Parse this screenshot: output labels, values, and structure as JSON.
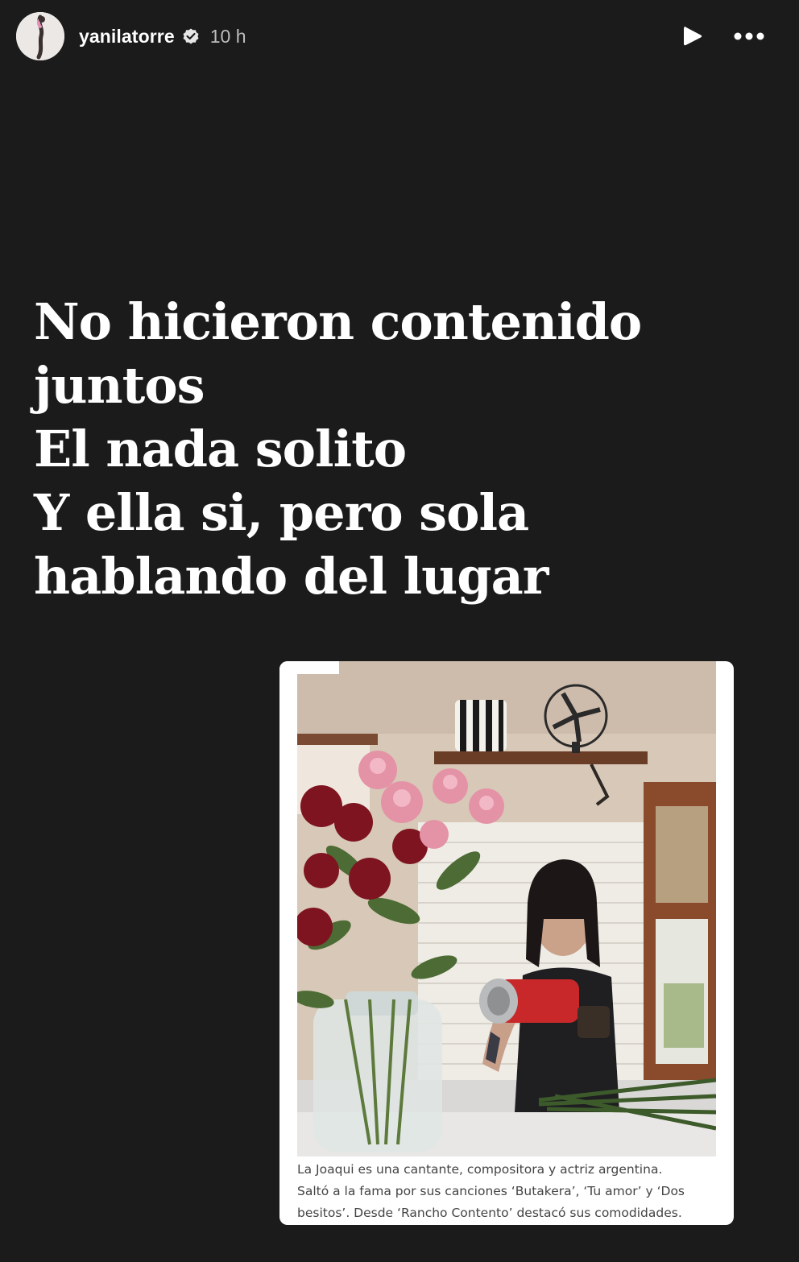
{
  "header": {
    "username": "yanilatorre",
    "time": "10 h",
    "avatar_icon": "profile-photo",
    "verified_icon": "verified-badge-icon",
    "play_icon": "play-icon",
    "more_icon": "more-horizontal-icon"
  },
  "caption": {
    "lines": [
      "No hicieron contenido",
      "juntos",
      "El nada solito",
      "Y ella si, pero sola",
      "hablando del lugar"
    ]
  },
  "card": {
    "caption_lines": [
      "La Joaqui es una cantante, compositora y actriz argentina.",
      "Saltó a la fama por sus canciones ‘Butakera’, ‘Tu amor’ y ‘Dos",
      "besitos’. Desde ‘Rancho Contento’ destacó sus comodidades."
    ]
  },
  "colors": {
    "background": "#1b1b1b",
    "text": "#ffffff",
    "muted": "#bdbdbd"
  }
}
